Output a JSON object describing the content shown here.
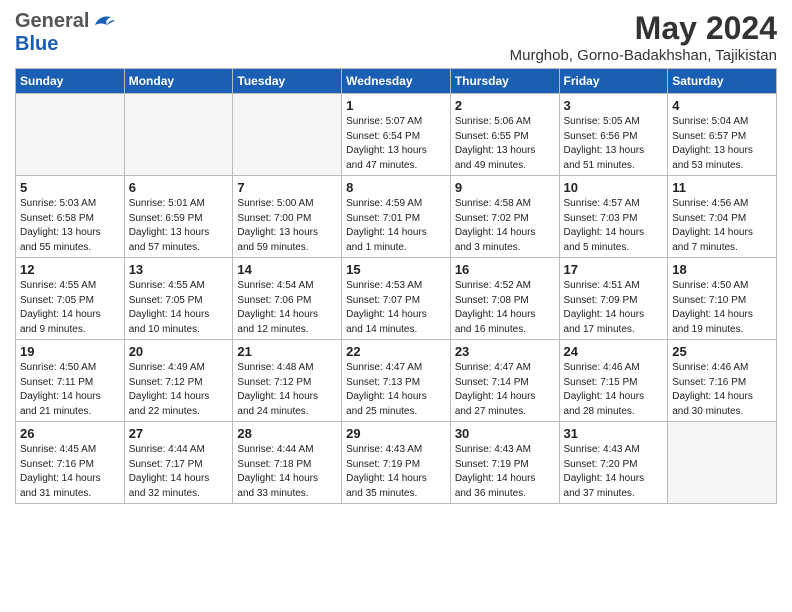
{
  "header": {
    "logo_general": "General",
    "logo_blue": "Blue",
    "month_title": "May 2024",
    "subtitle": "Murghob, Gorno-Badakhshan, Tajikistan"
  },
  "weekdays": [
    "Sunday",
    "Monday",
    "Tuesday",
    "Wednesday",
    "Thursday",
    "Friday",
    "Saturday"
  ],
  "weeks": [
    [
      {
        "day": "",
        "info": ""
      },
      {
        "day": "",
        "info": ""
      },
      {
        "day": "",
        "info": ""
      },
      {
        "day": "1",
        "info": "Sunrise: 5:07 AM\nSunset: 6:54 PM\nDaylight: 13 hours\nand 47 minutes."
      },
      {
        "day": "2",
        "info": "Sunrise: 5:06 AM\nSunset: 6:55 PM\nDaylight: 13 hours\nand 49 minutes."
      },
      {
        "day": "3",
        "info": "Sunrise: 5:05 AM\nSunset: 6:56 PM\nDaylight: 13 hours\nand 51 minutes."
      },
      {
        "day": "4",
        "info": "Sunrise: 5:04 AM\nSunset: 6:57 PM\nDaylight: 13 hours\nand 53 minutes."
      }
    ],
    [
      {
        "day": "5",
        "info": "Sunrise: 5:03 AM\nSunset: 6:58 PM\nDaylight: 13 hours\nand 55 minutes."
      },
      {
        "day": "6",
        "info": "Sunrise: 5:01 AM\nSunset: 6:59 PM\nDaylight: 13 hours\nand 57 minutes."
      },
      {
        "day": "7",
        "info": "Sunrise: 5:00 AM\nSunset: 7:00 PM\nDaylight: 13 hours\nand 59 minutes."
      },
      {
        "day": "8",
        "info": "Sunrise: 4:59 AM\nSunset: 7:01 PM\nDaylight: 14 hours\nand 1 minute."
      },
      {
        "day": "9",
        "info": "Sunrise: 4:58 AM\nSunset: 7:02 PM\nDaylight: 14 hours\nand 3 minutes."
      },
      {
        "day": "10",
        "info": "Sunrise: 4:57 AM\nSunset: 7:03 PM\nDaylight: 14 hours\nand 5 minutes."
      },
      {
        "day": "11",
        "info": "Sunrise: 4:56 AM\nSunset: 7:04 PM\nDaylight: 14 hours\nand 7 minutes."
      }
    ],
    [
      {
        "day": "12",
        "info": "Sunrise: 4:55 AM\nSunset: 7:05 PM\nDaylight: 14 hours\nand 9 minutes."
      },
      {
        "day": "13",
        "info": "Sunrise: 4:55 AM\nSunset: 7:05 PM\nDaylight: 14 hours\nand 10 minutes."
      },
      {
        "day": "14",
        "info": "Sunrise: 4:54 AM\nSunset: 7:06 PM\nDaylight: 14 hours\nand 12 minutes."
      },
      {
        "day": "15",
        "info": "Sunrise: 4:53 AM\nSunset: 7:07 PM\nDaylight: 14 hours\nand 14 minutes."
      },
      {
        "day": "16",
        "info": "Sunrise: 4:52 AM\nSunset: 7:08 PM\nDaylight: 14 hours\nand 16 minutes."
      },
      {
        "day": "17",
        "info": "Sunrise: 4:51 AM\nSunset: 7:09 PM\nDaylight: 14 hours\nand 17 minutes."
      },
      {
        "day": "18",
        "info": "Sunrise: 4:50 AM\nSunset: 7:10 PM\nDaylight: 14 hours\nand 19 minutes."
      }
    ],
    [
      {
        "day": "19",
        "info": "Sunrise: 4:50 AM\nSunset: 7:11 PM\nDaylight: 14 hours\nand 21 minutes."
      },
      {
        "day": "20",
        "info": "Sunrise: 4:49 AM\nSunset: 7:12 PM\nDaylight: 14 hours\nand 22 minutes."
      },
      {
        "day": "21",
        "info": "Sunrise: 4:48 AM\nSunset: 7:12 PM\nDaylight: 14 hours\nand 24 minutes."
      },
      {
        "day": "22",
        "info": "Sunrise: 4:47 AM\nSunset: 7:13 PM\nDaylight: 14 hours\nand 25 minutes."
      },
      {
        "day": "23",
        "info": "Sunrise: 4:47 AM\nSunset: 7:14 PM\nDaylight: 14 hours\nand 27 minutes."
      },
      {
        "day": "24",
        "info": "Sunrise: 4:46 AM\nSunset: 7:15 PM\nDaylight: 14 hours\nand 28 minutes."
      },
      {
        "day": "25",
        "info": "Sunrise: 4:46 AM\nSunset: 7:16 PM\nDaylight: 14 hours\nand 30 minutes."
      }
    ],
    [
      {
        "day": "26",
        "info": "Sunrise: 4:45 AM\nSunset: 7:16 PM\nDaylight: 14 hours\nand 31 minutes."
      },
      {
        "day": "27",
        "info": "Sunrise: 4:44 AM\nSunset: 7:17 PM\nDaylight: 14 hours\nand 32 minutes."
      },
      {
        "day": "28",
        "info": "Sunrise: 4:44 AM\nSunset: 7:18 PM\nDaylight: 14 hours\nand 33 minutes."
      },
      {
        "day": "29",
        "info": "Sunrise: 4:43 AM\nSunset: 7:19 PM\nDaylight: 14 hours\nand 35 minutes."
      },
      {
        "day": "30",
        "info": "Sunrise: 4:43 AM\nSunset: 7:19 PM\nDaylight: 14 hours\nand 36 minutes."
      },
      {
        "day": "31",
        "info": "Sunrise: 4:43 AM\nSunset: 7:20 PM\nDaylight: 14 hours\nand 37 minutes."
      },
      {
        "day": "",
        "info": ""
      }
    ]
  ]
}
